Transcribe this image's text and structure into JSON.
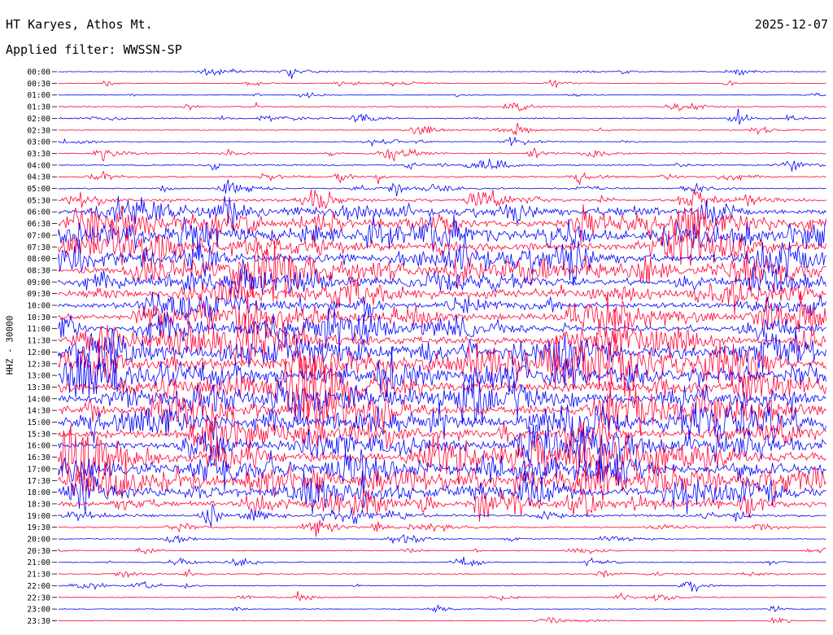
{
  "header": {
    "station": "HT Karyes, Athos Mt.",
    "date": "2025-12-07",
    "filter": "Applied filter: WWSSN-SP"
  },
  "chart_data": {
    "type": "helicorder",
    "title": "HT Karyes, Athos Mt.",
    "subtitle": "Applied filter: WWSSN-SP",
    "date": "2025-12-07",
    "ylabel": "HHZ - 30000",
    "line_interval_minutes": 30,
    "time_labels": [
      "00:00",
      "00:30",
      "01:00",
      "01:30",
      "02:00",
      "02:30",
      "03:00",
      "03:30",
      "04:00",
      "04:30",
      "05:00",
      "05:30",
      "06:00",
      "06:30",
      "07:00",
      "07:30",
      "08:00",
      "08:30",
      "09:00",
      "09:30",
      "10:00",
      "10:30",
      "11:00",
      "11:30",
      "12:00",
      "12:30",
      "13:00",
      "13:30",
      "14:00",
      "14:30",
      "15:00",
      "15:30",
      "16:00",
      "16:30",
      "17:00",
      "17:30",
      "18:00",
      "18:30",
      "19:00",
      "19:30",
      "20:00",
      "20:30",
      "21:00",
      "21:30",
      "22:00",
      "22:30",
      "23:00",
      "23:30"
    ],
    "activity_level": [
      0.12,
      0.12,
      0.1,
      0.25,
      0.3,
      0.22,
      0.1,
      0.3,
      0.35,
      0.3,
      0.3,
      0.55,
      0.75,
      0.8,
      0.9,
      0.95,
      0.95,
      0.9,
      0.85,
      0.8,
      0.8,
      0.85,
      0.85,
      0.9,
      1.0,
      1.0,
      1.0,
      1.0,
      1.0,
      1.0,
      1.0,
      1.0,
      1.0,
      0.95,
      1.0,
      1.0,
      0.95,
      0.8,
      0.5,
      0.35,
      0.12,
      0.15,
      0.2,
      0.2,
      0.18,
      0.15,
      0.12,
      0.12
    ],
    "trace_colors": [
      "#0000ff",
      "#ff0033"
    ],
    "axis_color": "#000000"
  }
}
